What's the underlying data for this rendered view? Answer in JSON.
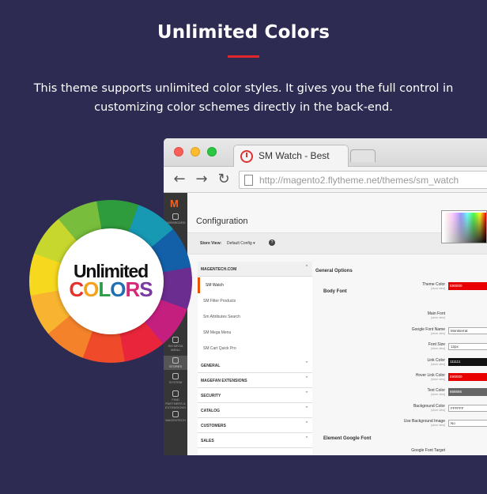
{
  "header": {
    "title": "Unlimited Colors",
    "description": "This theme supports unlimited color styles. It gives you the full control in customizing color schemes directly in the back-end."
  },
  "logo": {
    "line1": "Unlimited",
    "line2_letters": [
      "C",
      "O",
      "L",
      "O",
      "R",
      "S"
    ],
    "line2_colors": [
      "#e5322c",
      "#f4a11c",
      "#2d9b49",
      "#1f6fb5",
      "#d52a7a",
      "#7b3aa0"
    ]
  },
  "browser": {
    "tab_title": "SM Watch - Best",
    "url": "http://magento2.flytheme.net/themes/sm_watch"
  },
  "admin": {
    "sidebar": {
      "logo": "M",
      "items": [
        "DASHBOARD",
        "STORES",
        "SYSTEM",
        "FIND PARTNERS & EXTENSIONS",
        "MAGENTECH",
        "SM MEGA MENU"
      ]
    },
    "page_title": "Configuration",
    "store_view_label": "Store View:",
    "store_view_value": "Default Config ▾",
    "help": "?",
    "nav": {
      "open_group": "MAGENTECH.COM",
      "sub_items": [
        "SM Watch",
        "SM Filter Products",
        "Sm Attributes Search",
        "SM Mega Menu",
        "SM Cart Quick Pro"
      ],
      "groups": [
        "GENERAL",
        "MAGEFAN EXTENSIONS",
        "SECURITY",
        "CATALOG",
        "CUSTOMERS",
        "SALES"
      ]
    },
    "options": {
      "section": "General Options",
      "body_font": "Body Font",
      "element_font": "Element Google Font",
      "scope": "[store view]",
      "theme_color_label": "Theme Color",
      "theme_color_value": "E80000",
      "main_font_label": "Main Font",
      "google_font_name_label": "Google Font Name",
      "google_font_name_value": "Montserrat",
      "font_size_label": "Font Size",
      "font_size_value": "12px",
      "link_color_label": "Link Color",
      "link_color_value": "111111",
      "hover_link_color_label": "Hover Link Color",
      "hover_link_color_value": "E80000",
      "text_color_label": "Text Color",
      "text_color_value": "666666",
      "background_color_label": "Background Color",
      "background_color_value": "FFFFFF",
      "use_bg_image_label": "Use Background Image",
      "use_bg_image_value": "No",
      "google_font_target_label": "Google Font Target"
    }
  },
  "colors": {
    "background": "#2d2b52",
    "accent": "#e0262a",
    "theme_swatch": "#e80000",
    "link_swatch": "#111111",
    "text_swatch": "#666666"
  }
}
